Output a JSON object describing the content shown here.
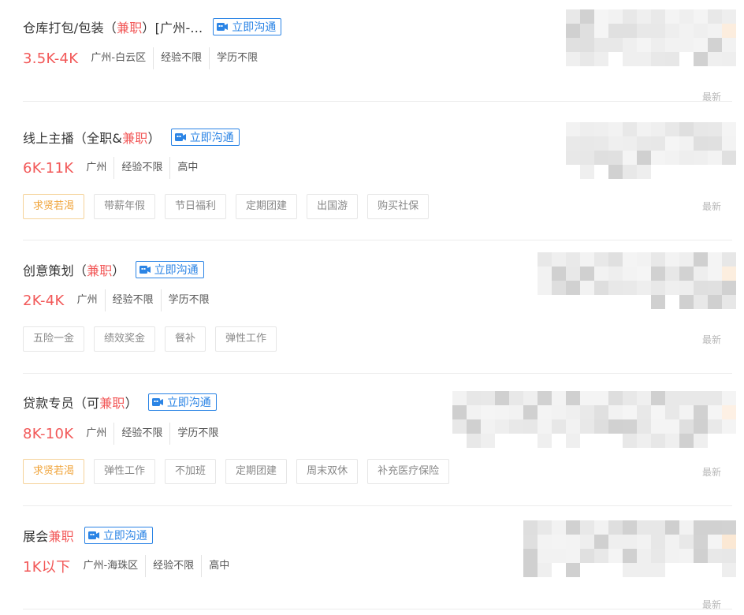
{
  "jobs": [
    {
      "title_before": "仓库打包/包装（",
      "title_hl": "兼职",
      "title_after": "）[广州-...",
      "chat_label": "立即沟通",
      "salary": "3.5K-4K",
      "meta": [
        "广州-白云区",
        "经验不限",
        "学历不限"
      ],
      "tags": [],
      "latest": "最新"
    },
    {
      "title_before": "线上主播（全职&",
      "title_hl": "兼职",
      "title_after": "）",
      "chat_label": "立即沟通",
      "salary": "6K-11K",
      "meta": [
        "广州",
        "经验不限",
        "高中"
      ],
      "tags": [
        "求贤若渴",
        "带薪年假",
        "节日福利",
        "定期团建",
        "出国游",
        "购买社保"
      ],
      "latest": "最新"
    },
    {
      "title_before": "创意策划（",
      "title_hl": "兼职",
      "title_after": "）",
      "chat_label": "立即沟通",
      "salary": "2K-4K",
      "meta": [
        "广州",
        "经验不限",
        "学历不限"
      ],
      "tags": [
        "五险一金",
        "绩效奖金",
        "餐补",
        "弹性工作"
      ],
      "latest": "最新"
    },
    {
      "title_before": "贷款专员（可",
      "title_hl": "兼职",
      "title_after": "）",
      "chat_label": "立即沟通",
      "salary": "8K-10K",
      "meta": [
        "广州",
        "经验不限",
        "学历不限"
      ],
      "tags": [
        "求贤若渴",
        "弹性工作",
        "不加班",
        "定期团建",
        "周末双休",
        "补充医疗保险"
      ],
      "latest": "最新"
    },
    {
      "title_before": "展会",
      "title_hl": "兼职",
      "title_after": "",
      "chat_label": "立即沟通",
      "salary": "1K以下",
      "meta": [
        "广州-海珠区",
        "经验不限",
        "高中"
      ],
      "tags": [],
      "latest": "最新"
    }
  ],
  "colors": {
    "accent_red": "#f25858",
    "link_blue": "#2b84e5",
    "hot_tag": "#f0a43a"
  },
  "icons": {
    "chat": "video-chat-icon"
  }
}
